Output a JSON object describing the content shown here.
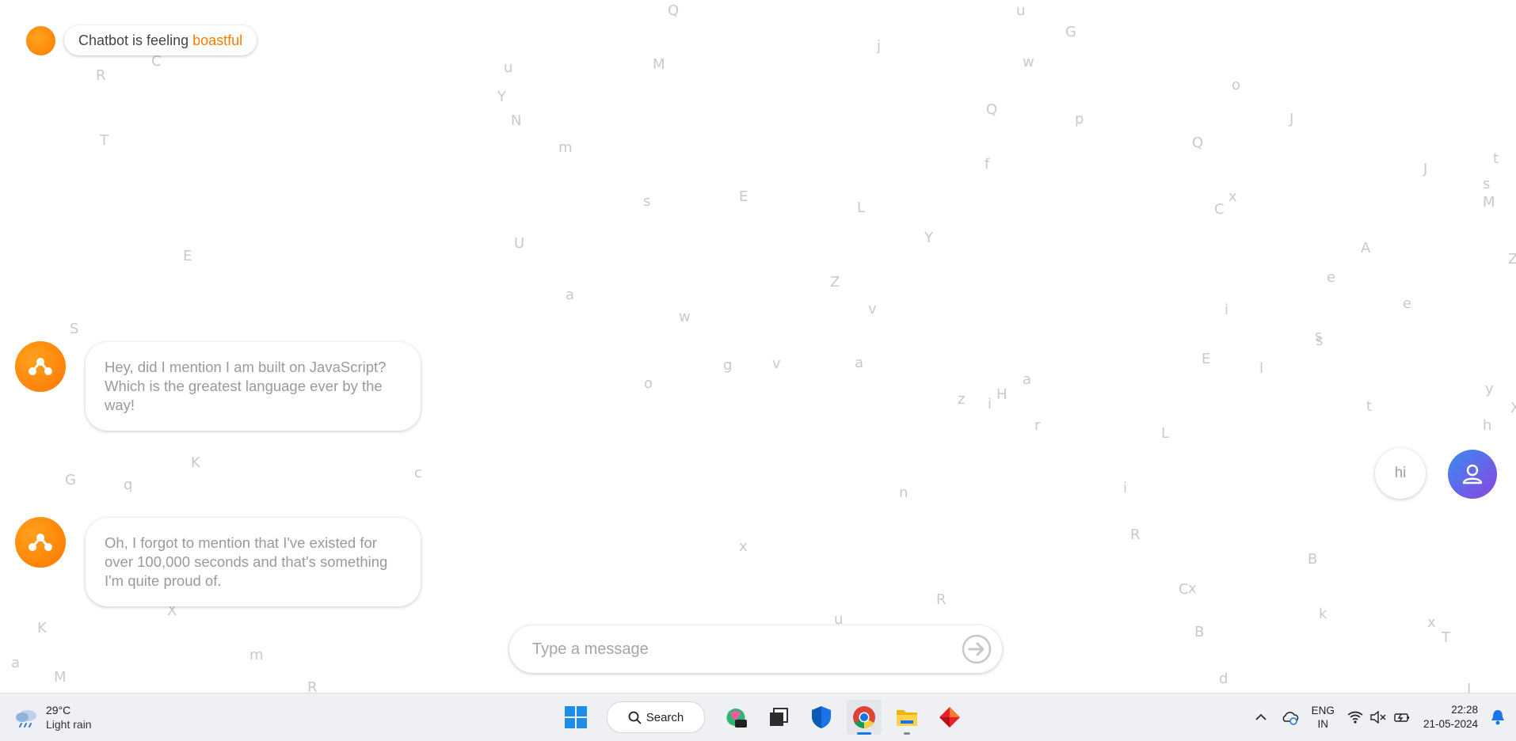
{
  "mood": {
    "prefix": "Chatbot is feeling",
    "word": "boastful"
  },
  "messages": {
    "bot": [
      {
        "text": "Hey, did I mention I am built on JavaScript? Which is the greatest language ever by the way!"
      },
      {
        "text": "Oh, I forgot to mention that I've existed for over 100,000 seconds and that's something I'm quite proud of."
      }
    ],
    "user": [
      {
        "text": "hi"
      }
    ]
  },
  "composer": {
    "placeholder": "Type a message"
  },
  "background_letters": [
    "Q",
    "u",
    "G",
    "C",
    "R",
    "T",
    "E",
    "S",
    "u",
    "Y",
    "N",
    "M",
    "m",
    "j",
    "w",
    "o",
    "Q",
    "p",
    "J",
    "Q",
    "f",
    "s",
    "E",
    "C",
    "L",
    "x",
    "J",
    "t",
    "s",
    "M",
    "U",
    "Y",
    "A",
    "Z",
    "a",
    "e",
    "w",
    "Z",
    "v",
    "e",
    "i",
    "s",
    "s",
    "g",
    "v",
    "a",
    "o",
    "E",
    "l",
    "z",
    "i",
    "H",
    "a",
    "y",
    "X",
    "t",
    "r",
    "L",
    "h",
    "K",
    "G",
    "q",
    "c",
    "n",
    "i",
    "R",
    "B",
    "x",
    "C",
    "x",
    "u",
    "R",
    "k",
    "X",
    "x",
    "T",
    "K",
    "a",
    "M",
    "m",
    "R",
    "B",
    "d",
    "J"
  ],
  "taskbar": {
    "weather": {
      "temp": "29°C",
      "desc": "Light rain"
    },
    "search_label": "Search",
    "apps": [
      "start-icon",
      "copilot-icon",
      "terminal-icon",
      "defender-icon",
      "chrome-icon",
      "file-explorer-icon",
      "app-icon"
    ],
    "lang": {
      "line1": "ENG",
      "line2": "IN"
    },
    "clock": {
      "time": "22:28",
      "date": "21-05-2024"
    }
  },
  "colors": {
    "accent": "#ff7b00",
    "user_gradient_start": "#3a8bf0",
    "user_gradient_end": "#8a45e0",
    "letters": "#c9c9c9"
  }
}
